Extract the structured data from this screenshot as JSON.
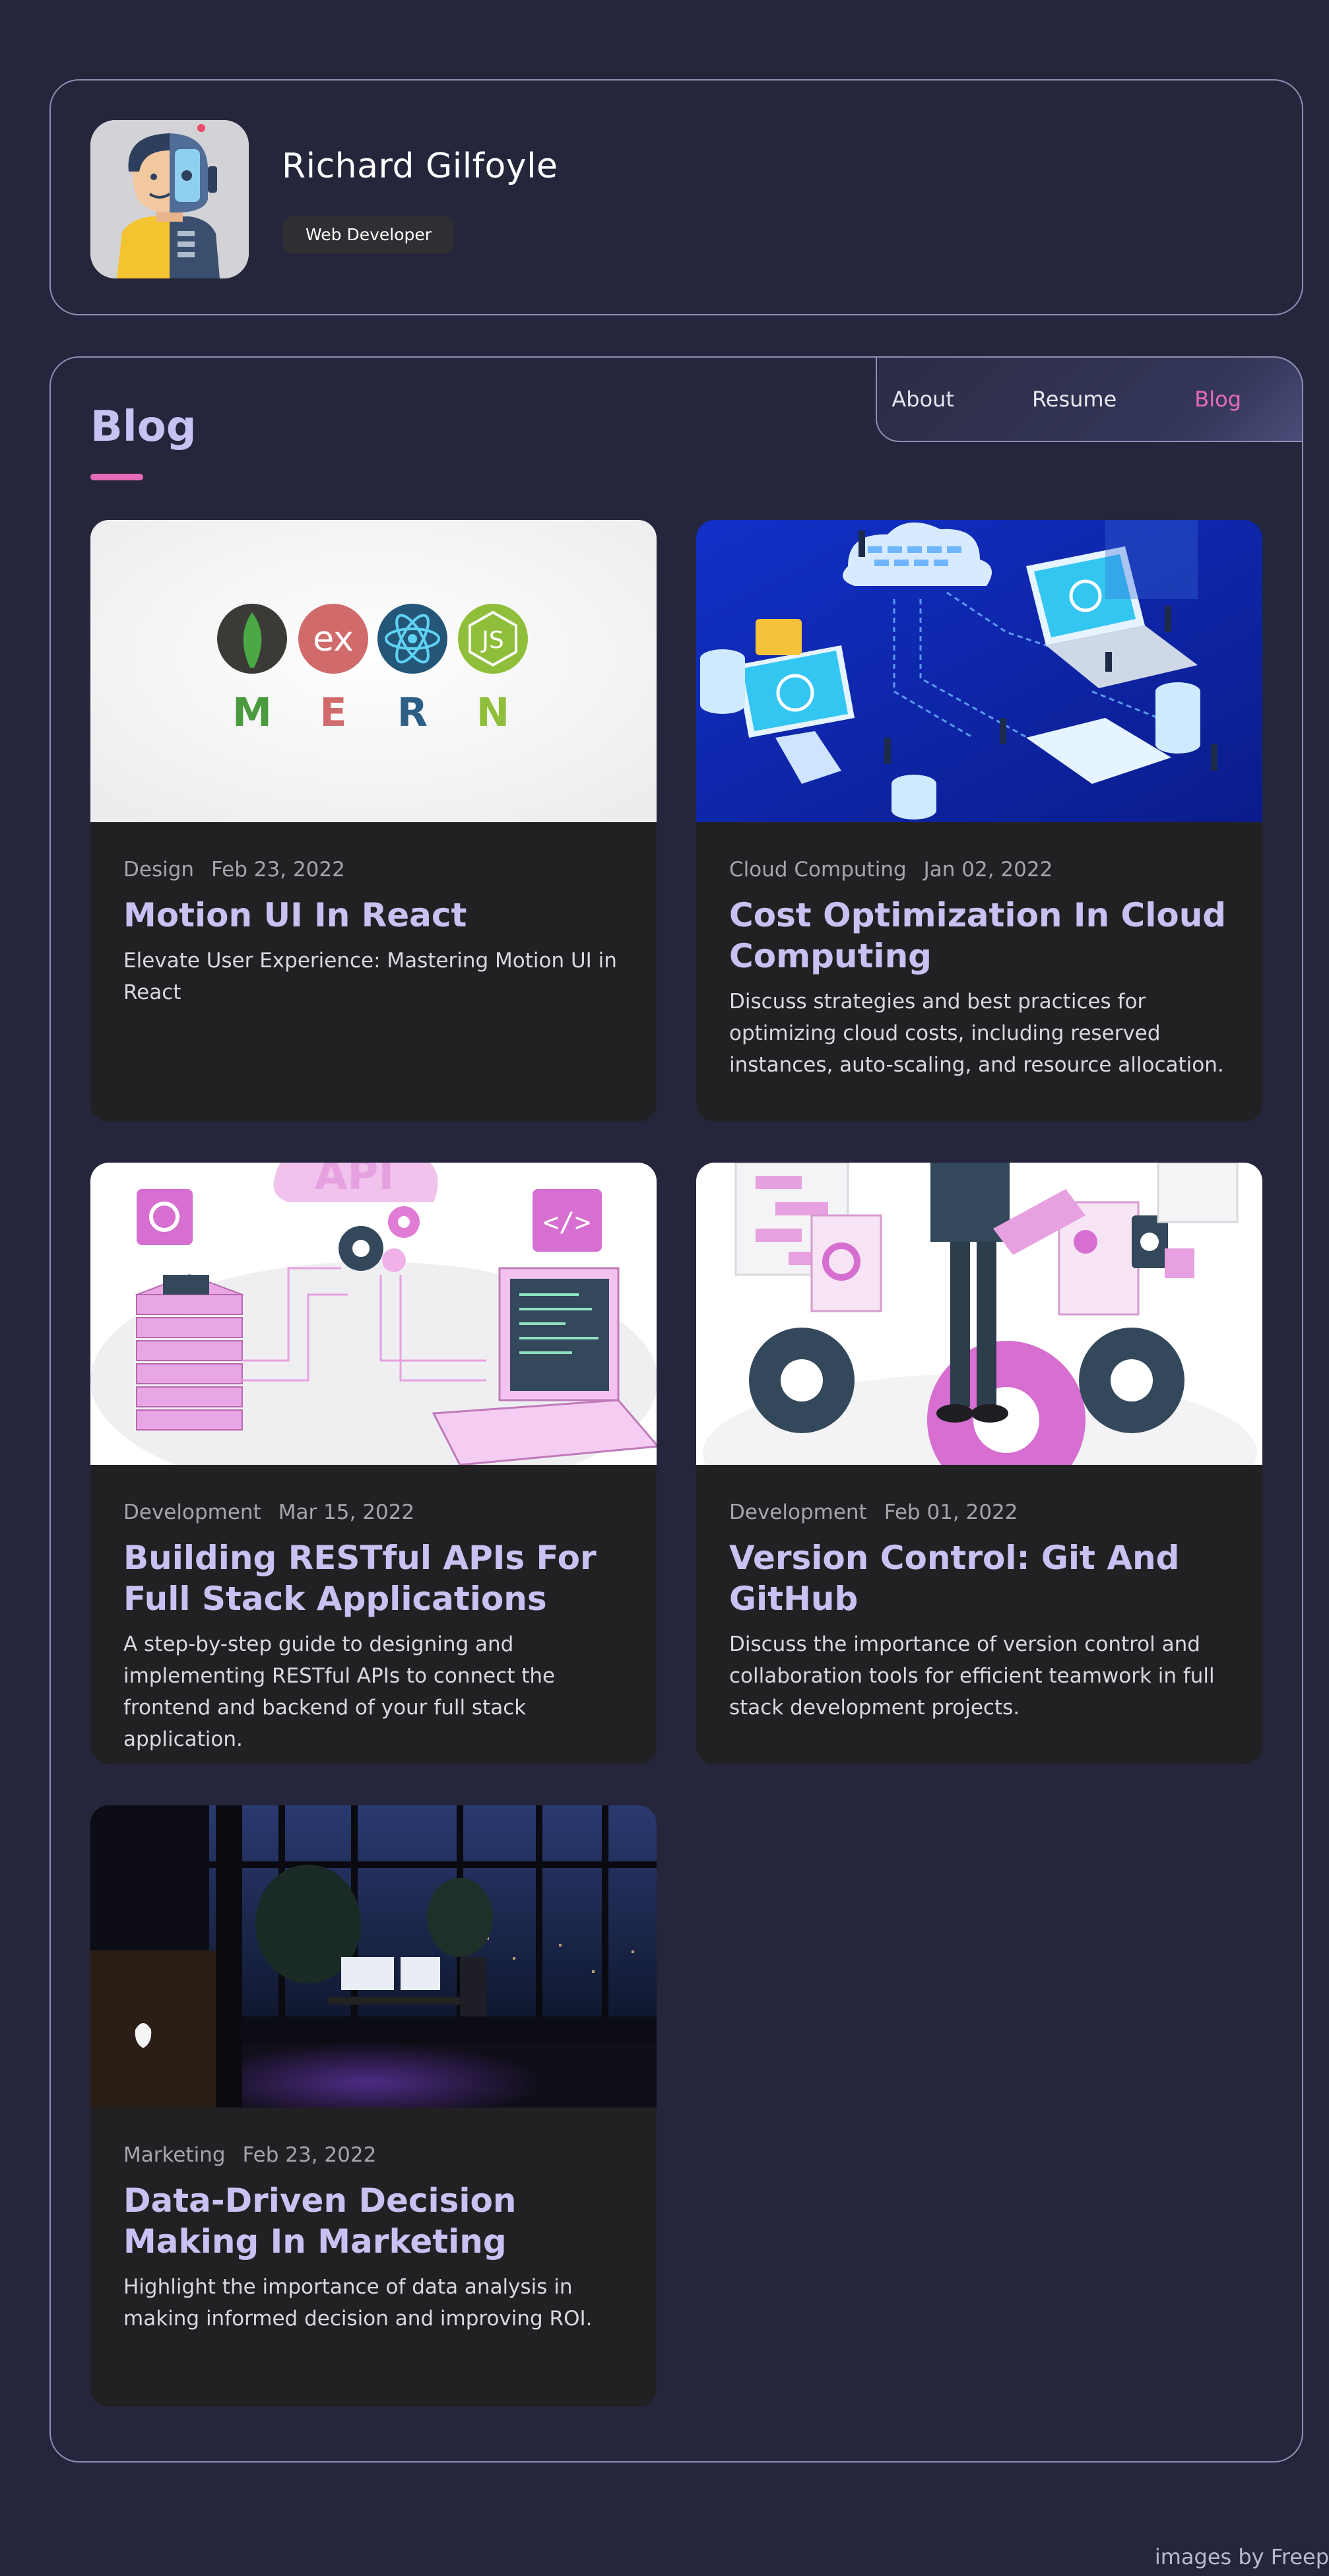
{
  "profile": {
    "name": "Richard Gilfoyle",
    "role": "Web Developer"
  },
  "nav": {
    "items": [
      {
        "label": "About",
        "active": false
      },
      {
        "label": "Resume",
        "active": false
      },
      {
        "label": "Blog",
        "active": true
      }
    ]
  },
  "section": {
    "title": "Blog"
  },
  "posts": [
    {
      "category": "Design",
      "date": "Feb 23, 2022",
      "title": "Motion UI In React",
      "description": "Elevate User Experience: Mastering Motion UI in React",
      "image": {
        "kind": "mern-logos",
        "letters": [
          "M",
          "E",
          "R",
          "N"
        ],
        "badge_text": [
          "ex",
          "JS"
        ]
      }
    },
    {
      "category": "Cloud Computing",
      "date": "Jan 02, 2022",
      "title": "Cost Optimization In Cloud Computing",
      "description": "Discuss strategies and best practices for optimizing cloud costs, including reserved instances, auto-scaling, and resource allocation.",
      "image": {
        "kind": "cloud-isometric-illustration"
      }
    },
    {
      "category": "Development",
      "date": "Mar 15, 2022",
      "title": "Building RESTful APIs For Full Stack Applications",
      "description": "A step-by-step guide to designing and implementing RESTful APIs to connect the frontend and backend of your full stack application.",
      "image": {
        "kind": "api-isometric-illustration",
        "sign_text": "API"
      }
    },
    {
      "category": "Development",
      "date": "Feb 01, 2022",
      "title": "Version Control: Git And GitHub",
      "description": "Discuss the importance of version control and collaboration tools for efficient teamwork in full stack development projects.",
      "image": {
        "kind": "version-control-illustration"
      }
    },
    {
      "category": "Marketing",
      "date": "Feb 23, 2022",
      "title": "Data-Driven Decision Making In Marketing",
      "description": "Highlight the importance of data analysis in making informed decision and improving ROI.",
      "image": {
        "kind": "night-office-photo"
      }
    }
  ],
  "credit": "images by Freep",
  "colors": {
    "background": "#25263c",
    "accent_pink": "#e66bb8",
    "title_lavender": "#c7c2f2",
    "card_bg": "#212123",
    "border": "#8c8fb3"
  }
}
